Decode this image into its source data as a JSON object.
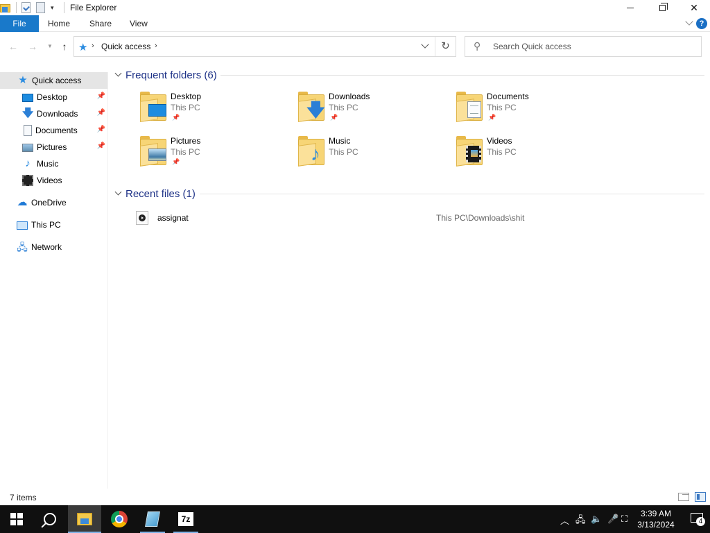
{
  "window": {
    "title": "File Explorer",
    "qat_dropdown": "▾"
  },
  "ribbon": {
    "tabs": [
      {
        "label": "File"
      },
      {
        "label": "Home"
      },
      {
        "label": "Share"
      },
      {
        "label": "View"
      }
    ],
    "help": "?"
  },
  "address": {
    "location": "Quick access",
    "search_placeholder": "Search Quick access"
  },
  "nav_pane": {
    "items": [
      {
        "label": "Quick access",
        "icon": "quick-access-star-icon",
        "selected": true
      },
      {
        "label": "Desktop",
        "icon": "desktop-icon",
        "pinned": true
      },
      {
        "label": "Downloads",
        "icon": "downloads-icon",
        "pinned": true
      },
      {
        "label": "Documents",
        "icon": "documents-icon",
        "pinned": true
      },
      {
        "label": "Pictures",
        "icon": "pictures-icon",
        "pinned": true
      },
      {
        "label": "Music",
        "icon": "music-icon"
      },
      {
        "label": "Videos",
        "icon": "videos-icon"
      },
      {
        "label": "OneDrive",
        "icon": "onedrive-cloud-icon"
      },
      {
        "label": "This PC",
        "icon": "this-pc-icon"
      },
      {
        "label": "Network",
        "icon": "network-icon"
      }
    ]
  },
  "frequent_folders": {
    "header": "Frequent folders (6)",
    "folders": [
      {
        "name": "Desktop",
        "location": "This PC",
        "pinned": true,
        "icon": "desktop-folder-icon"
      },
      {
        "name": "Downloads",
        "location": "This PC",
        "pinned": true,
        "icon": "downloads-folder-icon"
      },
      {
        "name": "Documents",
        "location": "This PC",
        "pinned": true,
        "icon": "documents-folder-icon"
      },
      {
        "name": "Pictures",
        "location": "This PC",
        "pinned": true,
        "icon": "pictures-folder-icon"
      },
      {
        "name": "Music",
        "location": "This PC",
        "pinned": false,
        "icon": "music-folder-icon"
      },
      {
        "name": "Videos",
        "location": "This PC",
        "pinned": false,
        "icon": "videos-folder-icon"
      }
    ]
  },
  "recent_files": {
    "header": "Recent files (1)",
    "files": [
      {
        "name": "assignat",
        "path": "This PC\\Downloads\\shit",
        "icon": "media-file-icon"
      }
    ]
  },
  "status": {
    "item_count": "7 items"
  },
  "taskbar": {
    "apps": [
      "start-icon",
      "search-icon",
      "file-explorer-icon",
      "chrome-icon",
      "notepad-icon",
      "7zip-icon"
    ],
    "sevenzip_label": "7z",
    "time": "3:39 AM",
    "date": "3/13/2024",
    "notification_count": "4"
  },
  "colors": {
    "accent": "#1979ca",
    "group_header": "#1e3287",
    "selected_nav": "#e5e5e5",
    "taskbar": "#101010"
  }
}
